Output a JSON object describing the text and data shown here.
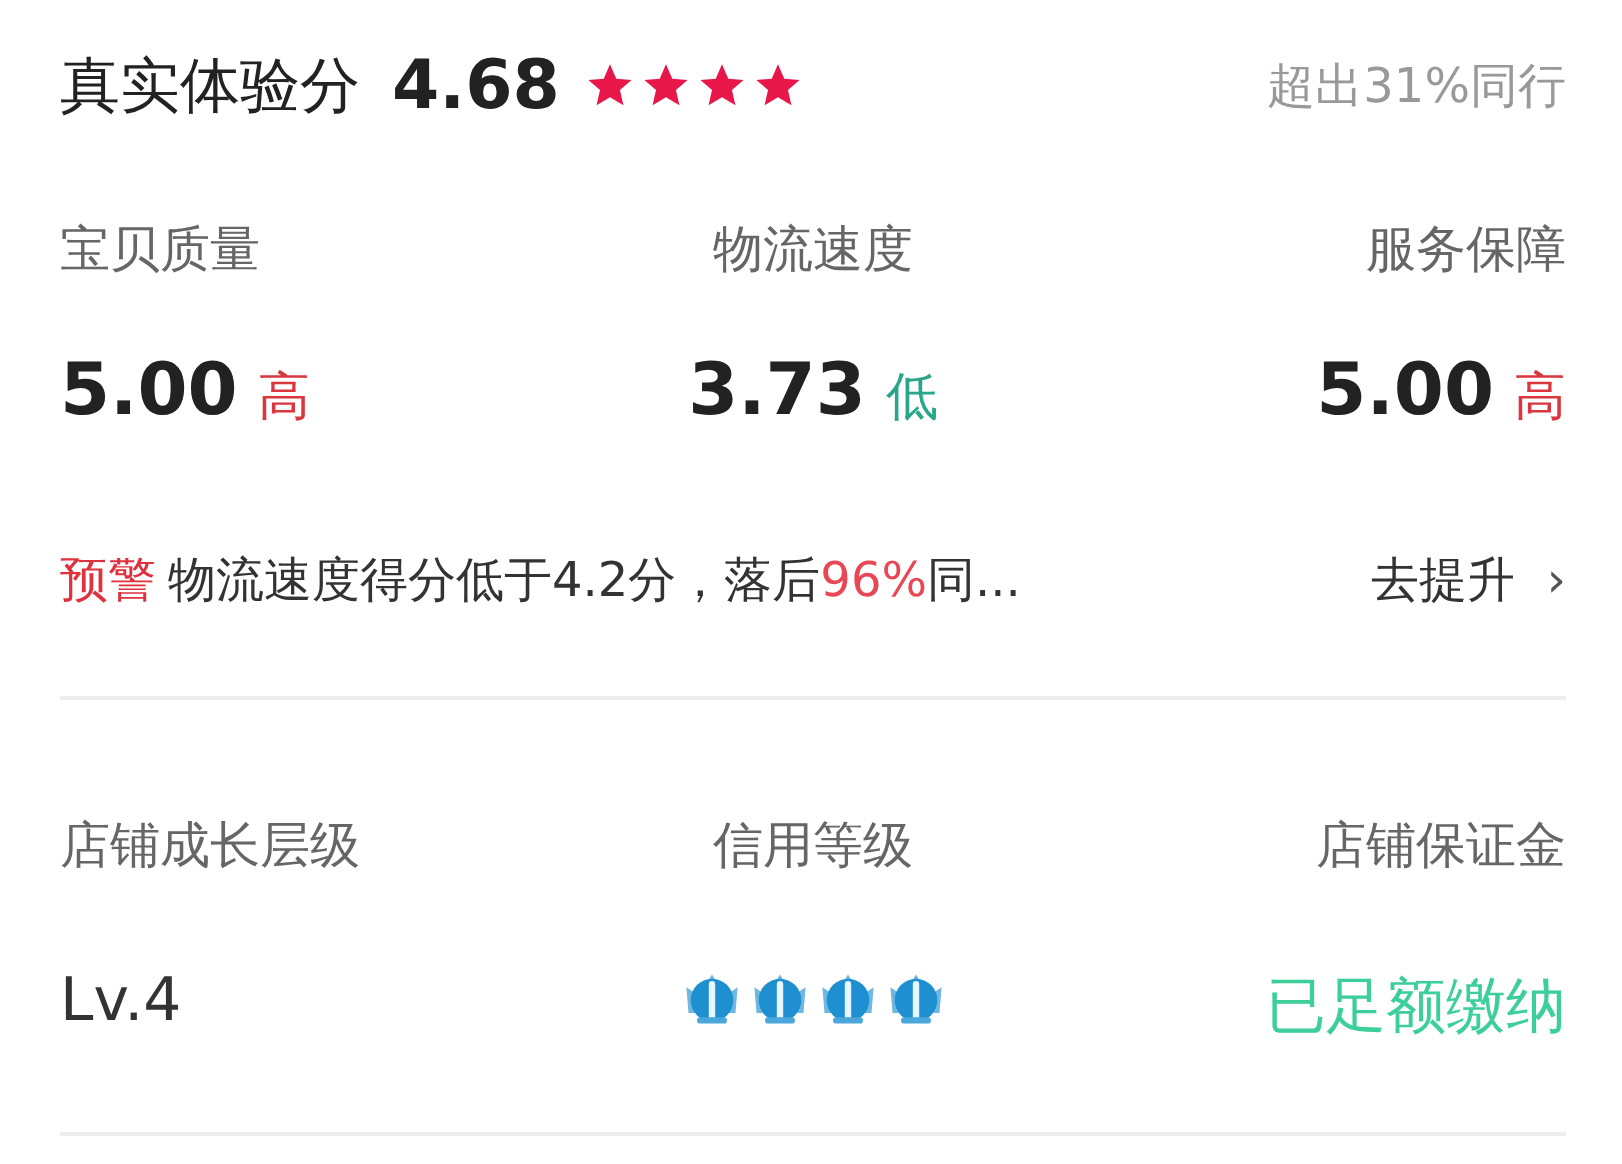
{
  "experience": {
    "title": "真实体验分",
    "score": "4.68",
    "stars": 4,
    "comparison": "超出31%同行"
  },
  "metrics": [
    {
      "label": "宝贝质量",
      "value": "5.00",
      "tag": "高",
      "kind": "high"
    },
    {
      "label": "物流速度",
      "value": "3.73",
      "tag": "低",
      "kind": "low"
    },
    {
      "label": "服务保障",
      "value": "5.00",
      "tag": "高",
      "kind": "high"
    }
  ],
  "warning": {
    "badge": "预警",
    "parts": [
      {
        "text": "物流速度得分低于4.2分，落后",
        "highlight": false
      },
      {
        "text": "96%",
        "highlight": true
      },
      {
        "text": "同...",
        "highlight": false
      }
    ],
    "action": "去提升",
    "arrow": "›"
  },
  "shop": [
    {
      "label": "店铺成长层级",
      "kind": "text",
      "value": "Lv.4"
    },
    {
      "label": "信用等级",
      "kind": "crowns",
      "stars": 4
    },
    {
      "label": "店铺保证金",
      "kind": "status",
      "value": "已足额缴纳"
    }
  ]
}
